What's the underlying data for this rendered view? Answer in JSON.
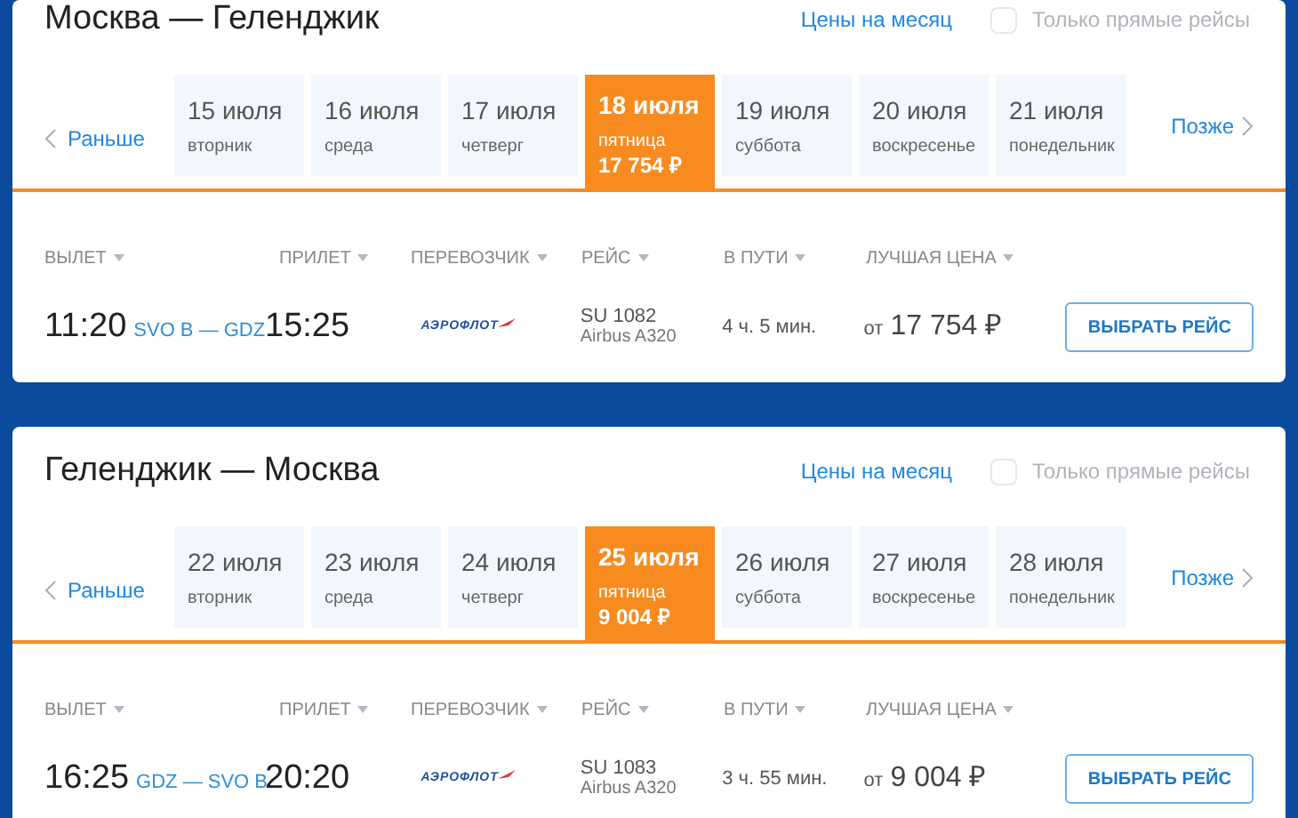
{
  "searches": [
    {
      "route": "Москва — Геленджик",
      "month_link": "Цены на месяц",
      "direct_only": {
        "label": "Только прямые рейсы",
        "checked": false
      },
      "earlier": "Раньше",
      "later": "Позже",
      "dates": [
        {
          "date": "15 июля",
          "weekday": "вторник",
          "selected": false
        },
        {
          "date": "16 июля",
          "weekday": "среда",
          "selected": false
        },
        {
          "date": "17 июля",
          "weekday": "четверг",
          "selected": false
        },
        {
          "date": "18 июля",
          "weekday": "пятница",
          "price": "17 754 ₽",
          "selected": true
        },
        {
          "date": "19 июля",
          "weekday": "суббота",
          "selected": false
        },
        {
          "date": "20 июля",
          "weekday": "воскресенье",
          "selected": false
        },
        {
          "date": "21 июля",
          "weekday": "понедельник",
          "selected": false
        }
      ],
      "columns": [
        "ВЫЛЕТ",
        "ПРИЛЕТ",
        "ПЕРЕВОЗЧИК",
        "РЕЙС",
        "В ПУТИ",
        "ЛУЧШАЯ ЦЕНА"
      ],
      "flight": {
        "departure": "11:20",
        "airports": "SVO B — GDZ",
        "arrival": "15:25",
        "carrier": "АЭРОФЛОТ",
        "number": "SU 1082",
        "aircraft": "Airbus A320",
        "duration": "4 ч. 5 мин.",
        "price_prefix": "от",
        "price": "17 754 ₽",
        "button": "ВЫБРАТЬ РЕЙС"
      }
    },
    {
      "route": "Геленджик — Москва",
      "month_link": "Цены на месяц",
      "direct_only": {
        "label": "Только прямые рейсы",
        "checked": false
      },
      "earlier": "Раньше",
      "later": "Позже",
      "dates": [
        {
          "date": "22 июля",
          "weekday": "вторник",
          "selected": false
        },
        {
          "date": "23 июля",
          "weekday": "среда",
          "selected": false
        },
        {
          "date": "24 июля",
          "weekday": "четверг",
          "selected": false
        },
        {
          "date": "25 июля",
          "weekday": "пятница",
          "price": "9 004 ₽",
          "selected": true
        },
        {
          "date": "26 июля",
          "weekday": "суббота",
          "selected": false
        },
        {
          "date": "27 июля",
          "weekday": "воскресенье",
          "selected": false
        },
        {
          "date": "28 июля",
          "weekday": "понедельник",
          "selected": false
        }
      ],
      "columns": [
        "ВЫЛЕТ",
        "ПРИЛЕТ",
        "ПЕРЕВОЗЧИК",
        "РЕЙС",
        "В ПУТИ",
        "ЛУЧШАЯ ЦЕНА"
      ],
      "flight": {
        "departure": "16:25",
        "airports": "GDZ — SVO B",
        "arrival": "20:20",
        "carrier": "АЭРОФЛОТ",
        "number": "SU 1083",
        "aircraft": "Airbus A320",
        "duration": "3 ч. 55 мин.",
        "price_prefix": "от",
        "price": "9 004 ₽",
        "button": "ВЫБРАТЬ РЕЙС"
      }
    }
  ]
}
